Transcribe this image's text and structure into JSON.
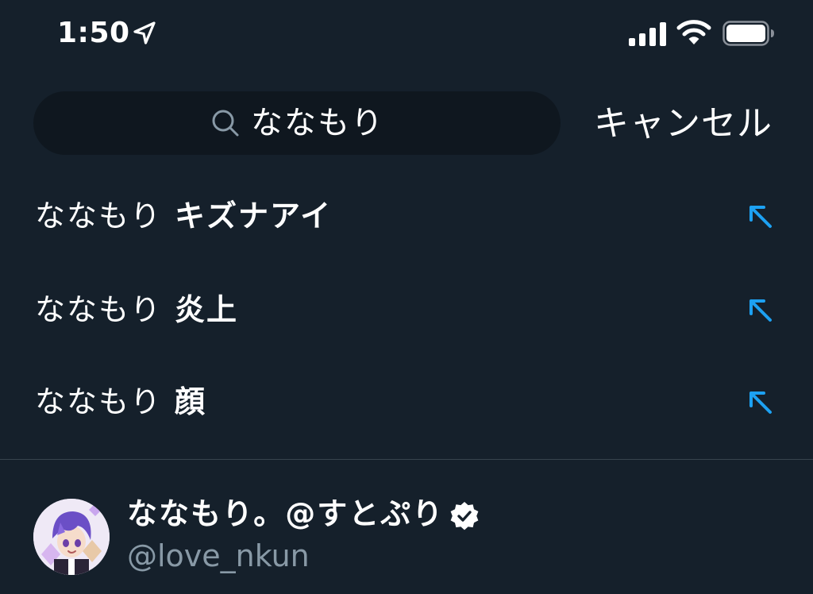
{
  "status_bar": {
    "time": "1:50"
  },
  "search": {
    "query": "ななもり",
    "cancel_label": "キャンセル"
  },
  "suggestions": [
    {
      "base": "ななもり",
      "bold": "キズナアイ"
    },
    {
      "base": "ななもり",
      "bold": "炎上"
    },
    {
      "base": "ななもり",
      "bold": "顔"
    }
  ],
  "account": {
    "name": "ななもり。@すとぷり",
    "handle": "@love_nkun",
    "verified": true
  },
  "colors": {
    "background": "#15202b",
    "search_background": "#0f171f",
    "accent": "#1da1f2",
    "secondary_text": "#8899a6",
    "divider": "#38444d"
  },
  "icons": {
    "location": "location-arrow-icon",
    "signal": "cellular-signal-icon",
    "wifi": "wifi-icon",
    "battery": "battery-icon",
    "search": "search-icon",
    "suggestion_fill": "arrow-up-left-icon",
    "verified": "verified-badge-icon"
  }
}
